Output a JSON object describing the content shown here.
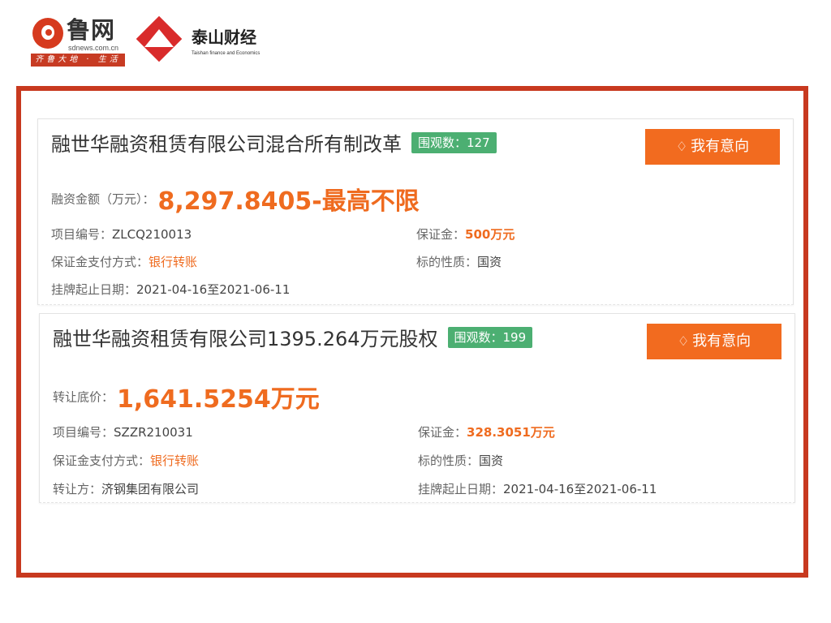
{
  "header": {
    "lu_name": "鲁网",
    "lu_url": "sdnews.com.cn",
    "lu_strip": "齐鲁大地 · 生活网",
    "ts_name": "泰山财经",
    "ts_en": "Taishan finance and Economics"
  },
  "listings": [
    {
      "title": "融世华融资租赁有限公司混合所有制改革",
      "views": "围观数：127",
      "intent_label": "我有意向",
      "price_label": "融资金额（万元）：",
      "price_value": "8,297.8405-最高不限",
      "project_no_label": "项目编号：",
      "project_no": "ZLCQ210013",
      "deposit_label": "保证金：",
      "deposit": "500万元",
      "pay_label": "保证金支付方式：",
      "pay": "银行转账",
      "nature_label": "标的性质：",
      "nature": "国资",
      "date_label": "挂牌起止日期：",
      "date": "2021-04-16至2021-06-11"
    },
    {
      "title": "融世华融资租赁有限公司1395.264万元股权",
      "views": "围观数：199",
      "intent_label": "我有意向",
      "price_label": "转让底价：",
      "price_value": "1,641.5254万元",
      "project_no_label": "项目编号：",
      "project_no": "SZZR210031",
      "deposit_label": "保证金：",
      "deposit": "328.3051万元",
      "pay_label": "保证金支付方式：",
      "pay": "银行转账",
      "nature_label": "标的性质：",
      "nature": "国资",
      "transferor_label": "转让方：",
      "transferor": "济钢集团有限公司",
      "date_label": "挂牌起止日期：",
      "date": "2021-04-16至2021-06-11"
    }
  ],
  "colors": {
    "frame": "#c8391f",
    "accent": "#ef6b1f",
    "button": "#f26b1f",
    "badge": "#4caf72"
  },
  "icons": {
    "intent": "hand-icon",
    "lu_logo": "lu-circle-logo-icon",
    "ts_logo": "mountain-diamond-logo-icon"
  }
}
